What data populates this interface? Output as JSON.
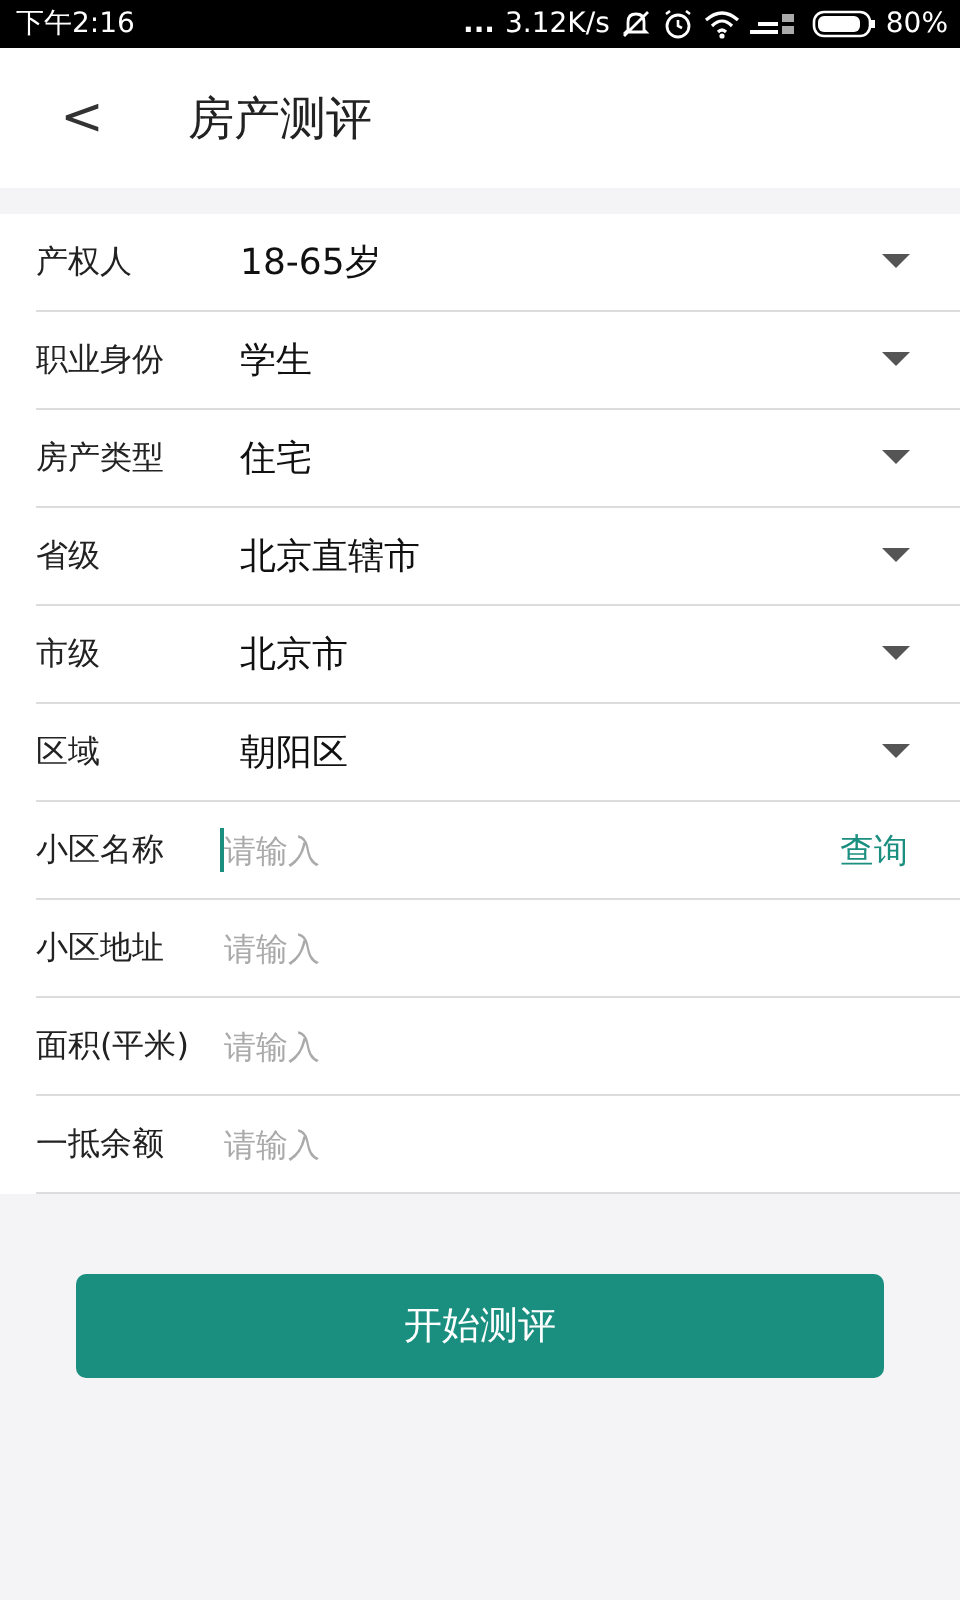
{
  "status_bar": {
    "time": "下午2:16",
    "dots": "...",
    "speed": "3.12K/s",
    "battery": "80%"
  },
  "header": {
    "back": "<",
    "title": "房产测评"
  },
  "rows": [
    {
      "kind": "select",
      "label": "产权人",
      "value": "18-65岁"
    },
    {
      "kind": "select",
      "label": "职业身份",
      "value": "学生"
    },
    {
      "kind": "select",
      "label": "房产类型",
      "value": "住宅"
    },
    {
      "kind": "select",
      "label": "省级",
      "value": "北京直辖市"
    },
    {
      "kind": "select",
      "label": "市级",
      "value": "北京市"
    },
    {
      "kind": "select",
      "label": "区域",
      "value": "朝阳区"
    },
    {
      "kind": "input",
      "label": "小区名称",
      "placeholder": "请输入",
      "focused": true,
      "action": "查询"
    },
    {
      "kind": "input",
      "label": "小区地址",
      "placeholder": "请输入",
      "focused": false
    },
    {
      "kind": "input",
      "label": "面积(平米)",
      "placeholder": "请输入",
      "focused": false
    },
    {
      "kind": "input",
      "label": "一抵余额",
      "placeholder": "请输入",
      "focused": false
    }
  ],
  "submit": "开始测评"
}
